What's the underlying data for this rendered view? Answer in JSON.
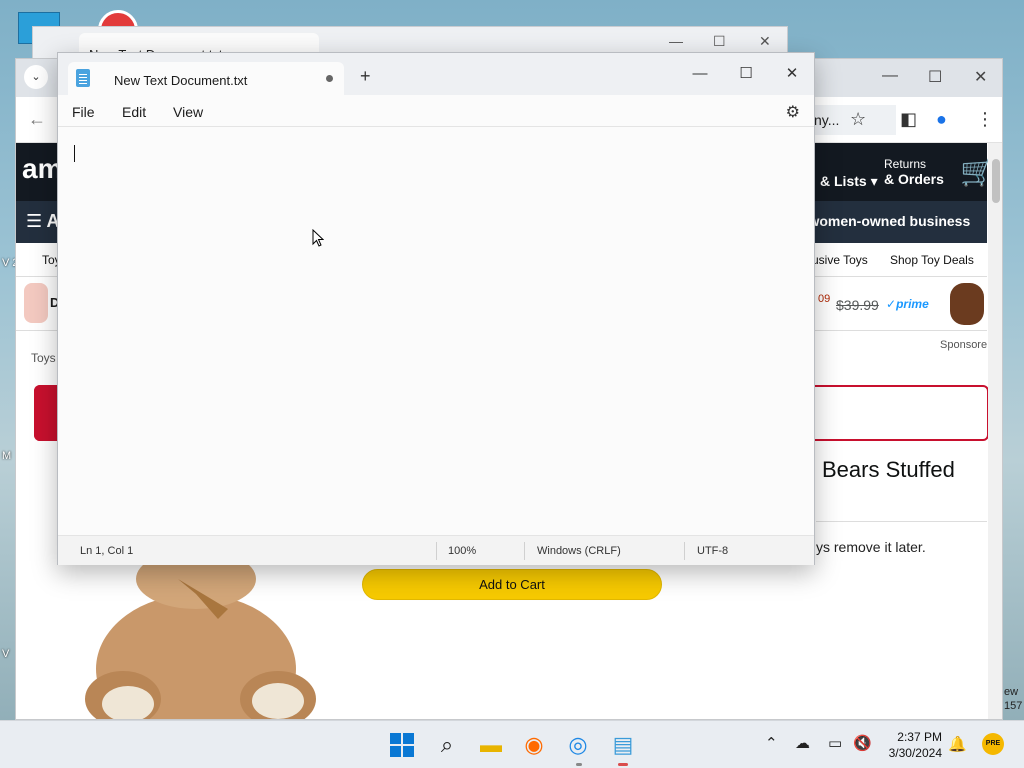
{
  "desktop": {
    "left_labels": [
      "V 20",
      "M",
      "V"
    ],
    "right_labels": [
      "ew",
      "157"
    ]
  },
  "back_window": {
    "tab_title": "New Text Document.txt"
  },
  "browser": {
    "omnibox_text": "ny...",
    "amazon": {
      "logo_text": "am",
      "lists_label": "& Lists",
      "returns_line1": "Returns",
      "returns_line2": "& Orders",
      "menu_label": "A",
      "promo": "p women-owned business",
      "links_left": "Toy",
      "links": [
        "usive Toys",
        "Shop Toy Deals"
      ],
      "ad_price_partial": "09",
      "ad_price_old": "$39.99",
      "ad_prime": "prime",
      "ad_brand_partial": "D",
      "sponsored": "Sponsore",
      "breadcrumb": "Toys",
      "product_title_partial": "Bears Stuffed",
      "notice_partial": "ys remove it later.",
      "add_to_cart": "Add to Cart"
    }
  },
  "notepad": {
    "tab_title": "New Text Document.txt",
    "menu": {
      "file": "File",
      "edit": "Edit",
      "view": "View"
    },
    "status": {
      "position": "Ln 1, Col 1",
      "zoom": "100%",
      "line_ending": "Windows (CRLF)",
      "encoding": "UTF-8"
    },
    "content": ""
  },
  "taskbar": {
    "time": "2:37 PM",
    "date": "3/30/2024",
    "pre_badge": "PRE"
  },
  "colors": {
    "amazon_nav": "#131921",
    "amazon_subnav": "#232f3e",
    "add_to_cart": "#f7ca00",
    "accent": "#0a78d4"
  }
}
